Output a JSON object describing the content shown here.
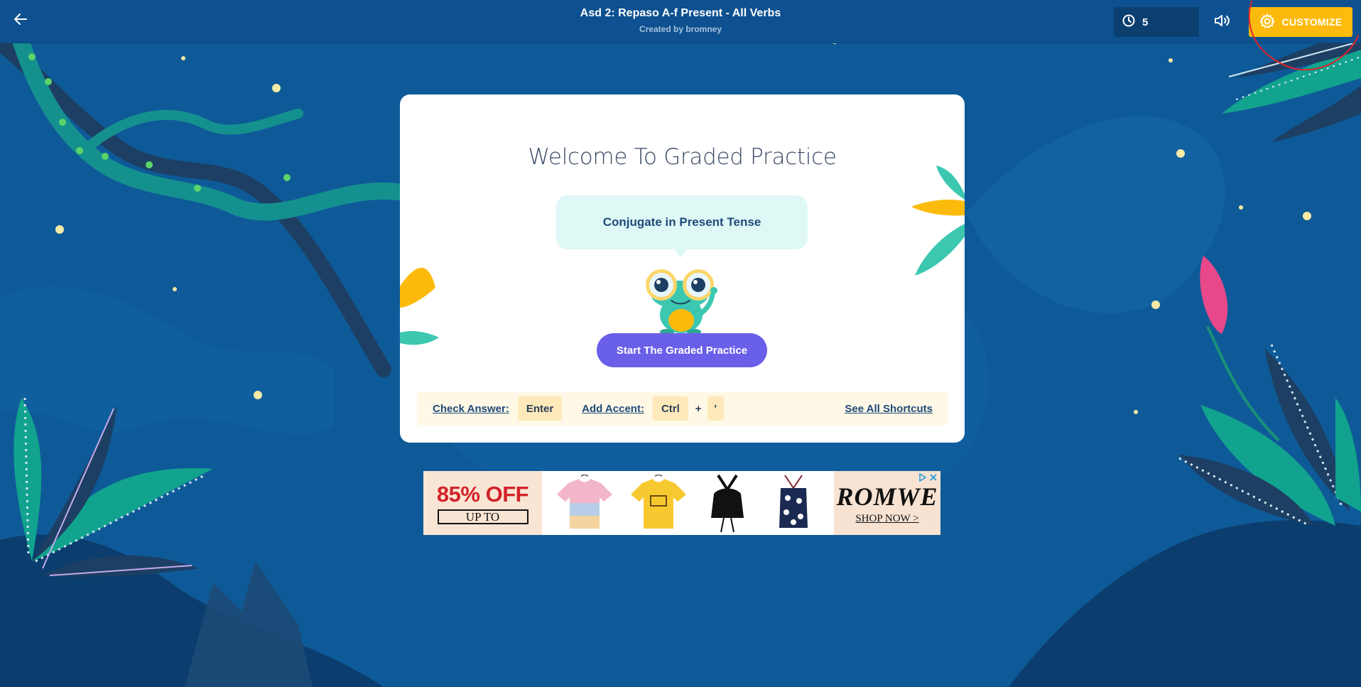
{
  "header": {
    "title": "Asd 2: Repaso A-f Present - All Verbs",
    "subtitle": "Created by bromney",
    "timer_value": "5",
    "customize_label": "CUSTOMIZE"
  },
  "card": {
    "welcome": "Welcome To Graded Practice",
    "bubble_text": "Conjugate in Present Tense",
    "start_label": "Start The Graded Practice",
    "shortcuts": {
      "check_label": "Check Answer:",
      "check_key": "Enter",
      "accent_label": "Add Accent:",
      "accent_key": "Ctrl",
      "plus": "+",
      "accent_key2": "'",
      "see_all": "See All Shortcuts"
    }
  },
  "ad": {
    "discount": "85% OFF",
    "upto": "UP TO",
    "brand": "ROMWE",
    "shop": "SHOP NOW >"
  },
  "colors": {
    "accent": "#fcbb0c",
    "primary_button": "#6a5fe8",
    "header_bg": "#0d5190",
    "page_bg": "#0e5a98"
  }
}
